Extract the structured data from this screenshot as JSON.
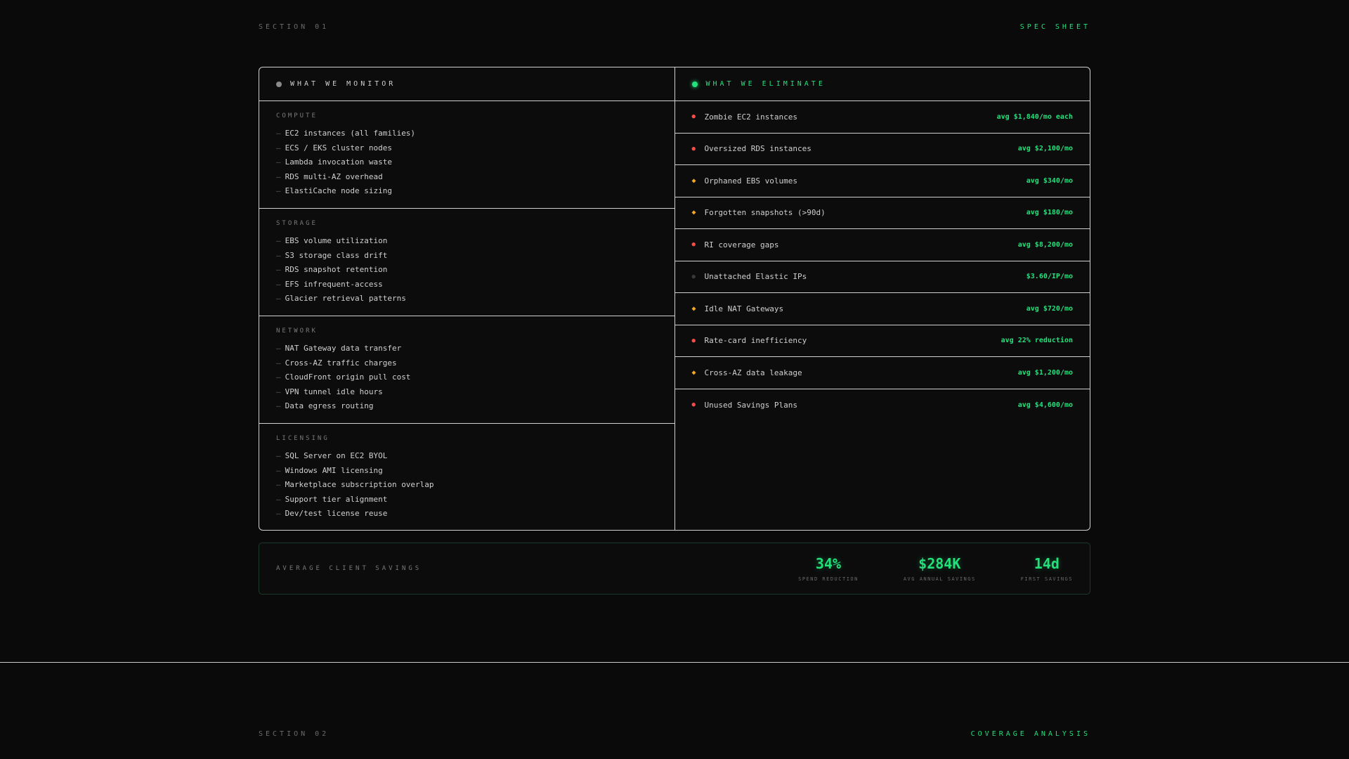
{
  "section1": {
    "label": "SECTION 01",
    "tag": "SPEC SHEET"
  },
  "section2": {
    "label": "SECTION 02",
    "tag": "COVERAGE ANALYSIS"
  },
  "colors": {
    "accent": "#22e07a",
    "critical": "#ff4a4a",
    "warning": "#f5a623",
    "muted": "#3a3a3a"
  },
  "monitor": {
    "title": "WHAT WE MONITOR",
    "groups": [
      {
        "title": "COMPUTE",
        "items": [
          "EC2 instances (all families)",
          "ECS / EKS cluster nodes",
          "Lambda invocation waste",
          "RDS multi-AZ overhead",
          "ElastiCache node sizing"
        ]
      },
      {
        "title": "STORAGE",
        "items": [
          "EBS volume utilization",
          "S3 storage class drift",
          "RDS snapshot retention",
          "EFS infrequent-access",
          "Glacier retrieval patterns"
        ]
      },
      {
        "title": "NETWORK",
        "items": [
          "NAT Gateway data transfer",
          "Cross-AZ traffic charges",
          "CloudFront origin pull cost",
          "VPN tunnel idle hours",
          "Data egress routing"
        ]
      },
      {
        "title": "LICENSING",
        "items": [
          "SQL Server on EC2 BYOL",
          "Windows AMI licensing",
          "Marketplace subscription overlap",
          "Support tier alignment",
          "Dev/test license reuse"
        ]
      }
    ]
  },
  "eliminate": {
    "title": "WHAT WE ELIMINATE",
    "items": [
      {
        "severity": "critical",
        "name": "Zombie EC2 instances",
        "value": "avg $1,840/mo each"
      },
      {
        "severity": "critical",
        "name": "Oversized RDS instances",
        "value": "avg $2,100/mo"
      },
      {
        "severity": "warning",
        "name": "Orphaned EBS volumes",
        "value": "avg $340/mo"
      },
      {
        "severity": "warning",
        "name": "Forgotten snapshots (>90d)",
        "value": "avg $180/mo"
      },
      {
        "severity": "critical",
        "name": "RI coverage gaps",
        "value": "avg $8,200/mo"
      },
      {
        "severity": "low",
        "name": "Unattached Elastic IPs",
        "value": "$3.60/IP/mo"
      },
      {
        "severity": "warning",
        "name": "Idle NAT Gateways",
        "value": "avg $720/mo"
      },
      {
        "severity": "critical",
        "name": "Rate-card inefficiency",
        "value": "avg 22% reduction"
      },
      {
        "severity": "warning",
        "name": "Cross-AZ data leakage",
        "value": "avg $1,200/mo"
      },
      {
        "severity": "critical",
        "name": "Unused Savings Plans",
        "value": "avg $4,600/mo"
      }
    ]
  },
  "savings": {
    "title": "AVERAGE CLIENT SAVINGS",
    "stats": [
      {
        "value": "34%",
        "label": "SPEND REDUCTION"
      },
      {
        "value": "$284K",
        "label": "AVG ANNUAL SAVINGS"
      },
      {
        "value": "14d",
        "label": "FIRST SAVINGS"
      }
    ]
  }
}
